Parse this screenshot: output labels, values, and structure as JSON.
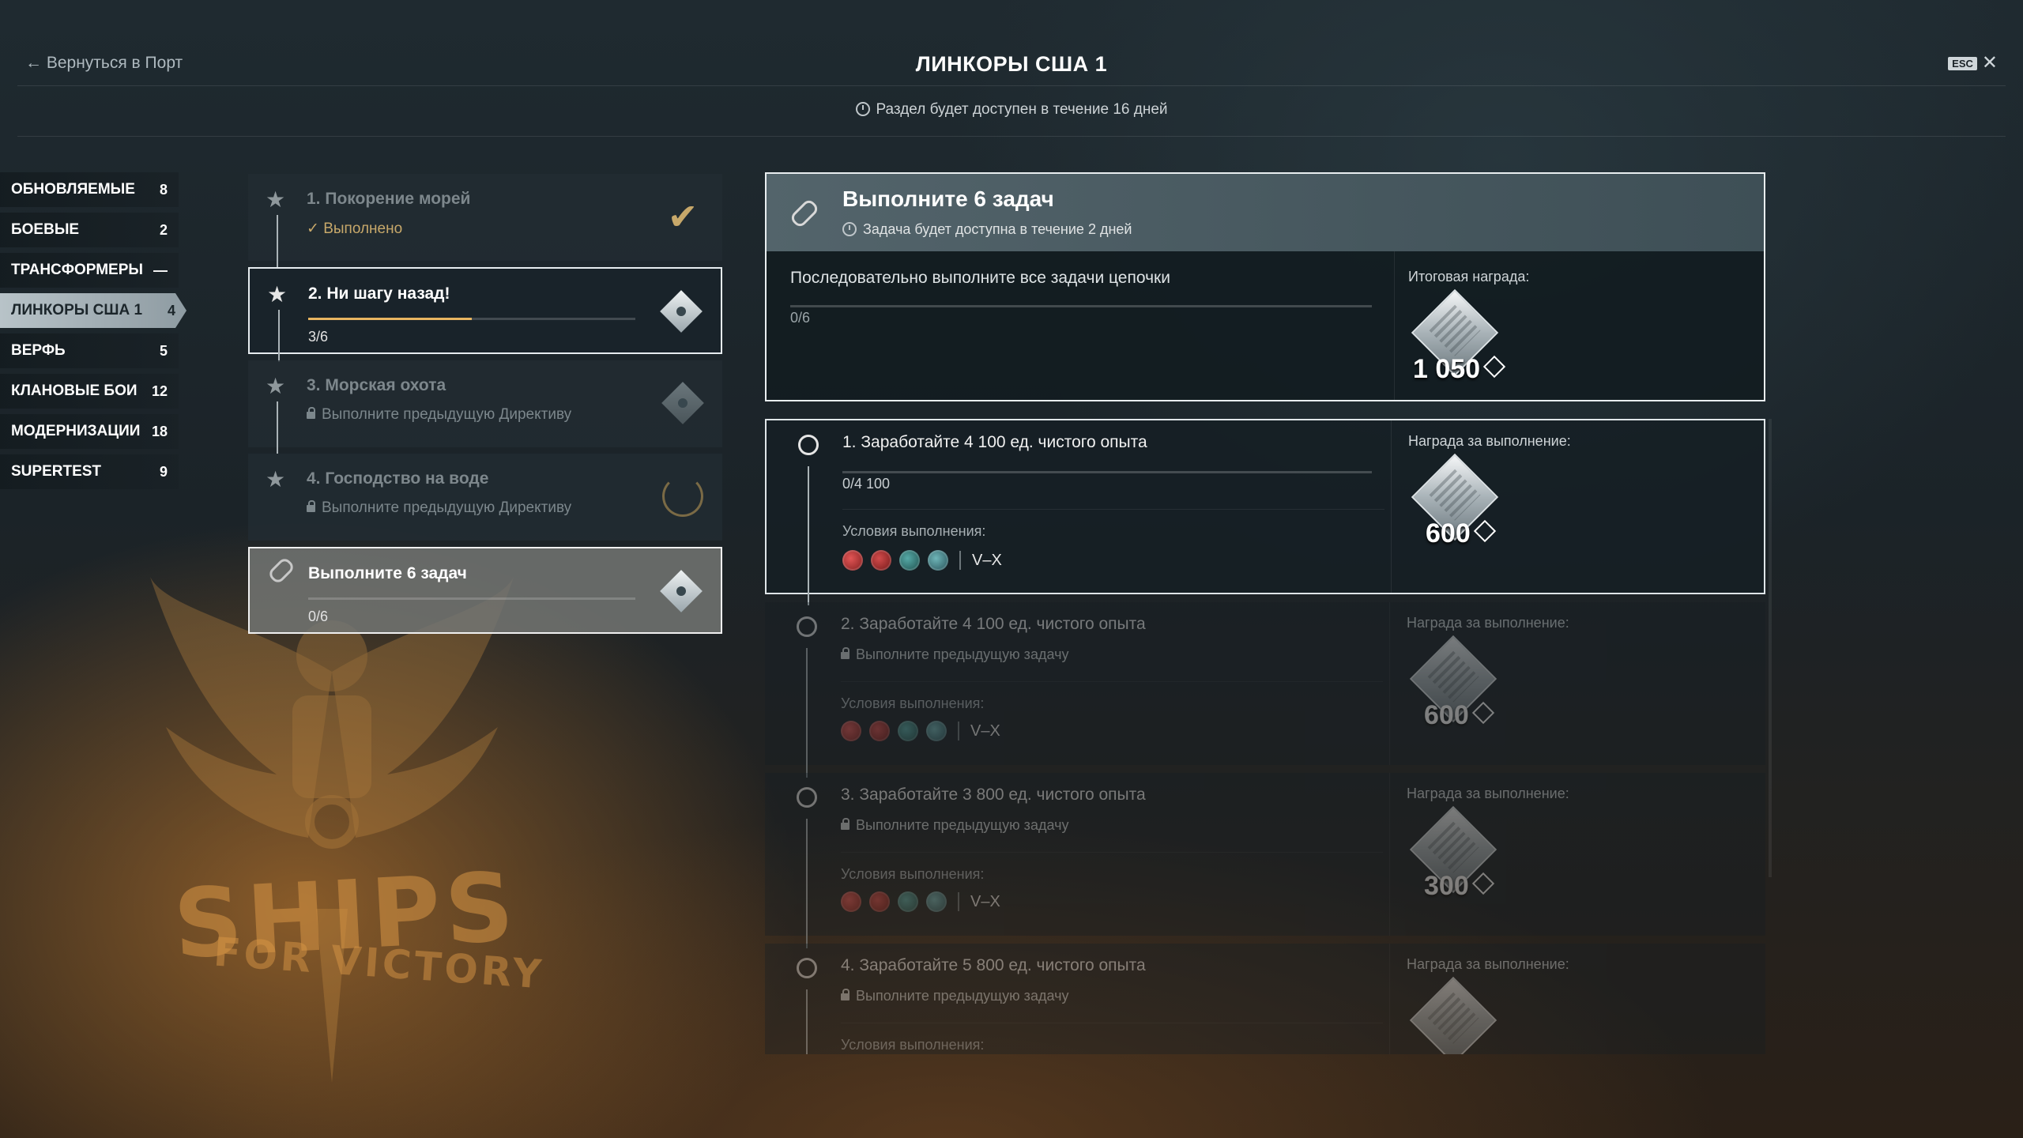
{
  "header": {
    "back_label": "← Вернуться в Порт",
    "title": "ЛИНКОРЫ США 1",
    "esc_label": "ESC",
    "close_glyph": "✕",
    "availability": "Раздел будет доступен в течение 16 дней"
  },
  "sidebar": {
    "items": [
      {
        "label": "ОБНОВЛЯЕМЫЕ",
        "count": "8"
      },
      {
        "label": "БОЕВЫЕ",
        "count": "2"
      },
      {
        "label": "ТРАНСФОРМЕРЫ",
        "count": "—"
      },
      {
        "label": "ЛИНКОРЫ США 1",
        "count": "4",
        "active": true
      },
      {
        "label": "ВЕРФЬ",
        "count": "5"
      },
      {
        "label": "КЛАНОВЫЕ БОИ",
        "count": "12"
      },
      {
        "label": "МОДЕРНИЗАЦИИ",
        "count": "18"
      },
      {
        "label": "SUPERTEST",
        "count": "9"
      }
    ]
  },
  "emblem": {
    "line1": "SHIPS",
    "line2": "FOR VICTORY"
  },
  "directives": [
    {
      "title": "1. Покорение морей",
      "status": "Выполнено",
      "state": "done"
    },
    {
      "title": "2. Ни шагу назад!",
      "progress": "3/6",
      "fraction": 0.5,
      "state": "selected"
    },
    {
      "title": "3. Морская охота",
      "status": "Выполните предыдущую Директиву",
      "state": "locked"
    },
    {
      "title": "4. Господство на воде",
      "status": "Выполните предыдущую Директиву",
      "state": "locked"
    },
    {
      "title": "Выполните 6 задач",
      "progress": "0/6",
      "fraction": 0,
      "state": "current"
    }
  ],
  "chain": {
    "title": "Выполните 6 задач",
    "timer": "Задача будет доступна в течение 2 дней",
    "description": "Последовательно выполните все задачи цепочки",
    "progress": "0/6",
    "reward_label": "Итоговая награда:",
    "reward_amount": "1 050"
  },
  "tasks": [
    {
      "title": "1. Заработайте 4 100 ед. чистого опыта",
      "progress": "0/4 100",
      "conditions_label": "Условия выполнения:",
      "tier": "V–X",
      "reward_label": "Награда за выполнение:",
      "reward_amount": "600"
    },
    {
      "title": "2. Заработайте 4 100 ед. чистого опыта",
      "locked_text": "Выполните предыдущую задачу",
      "conditions_label": "Условия выполнения:",
      "tier": "V–X",
      "reward_label": "Награда за выполнение:",
      "reward_amount": "600"
    },
    {
      "title": "3. Заработайте 3 800 ед. чистого опыта",
      "locked_text": "Выполните предыдущую задачу",
      "conditions_label": "Условия выполнения:",
      "tier": "V–X",
      "reward_label": "Награда за выполнение:",
      "reward_amount": "300"
    },
    {
      "title": "4. Заработайте 5 800 ед. чистого опыта",
      "locked_text": "Выполните предыдущую задачу",
      "conditions_label": "Условия выполнения:",
      "reward_label": "Награда за выполнение:"
    }
  ],
  "colors": {
    "progress_fill": "#e8b560",
    "done": "#c7a86a",
    "accent_light": "#e9eef0"
  },
  "icons": {
    "back": "arrow-left-icon",
    "clock": "clock-icon",
    "lock": "lock-icon",
    "chain": "chain-link-icon",
    "check": "check-icon",
    "star": "star-icon"
  }
}
